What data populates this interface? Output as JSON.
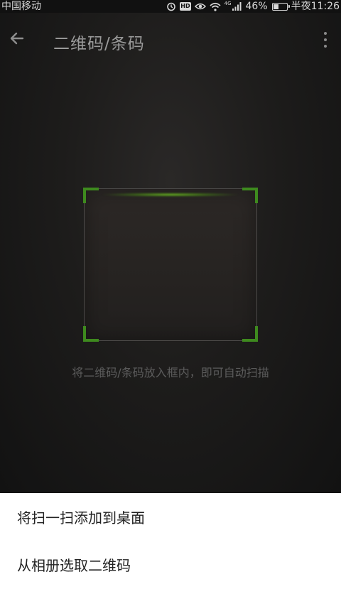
{
  "status_bar": {
    "carrier": "中国移动",
    "net_label": "4G",
    "battery_percent": "46%",
    "battery_level": 0.46,
    "time": "半夜11:26",
    "icons": [
      "alarm-icon",
      "hd-icon",
      "eye-icon",
      "wifi-icon",
      "signal-icon",
      "battery-icon"
    ],
    "hd_label": "HD"
  },
  "app_bar": {
    "title": "二维码/条码",
    "back_icon": "arrow-left-icon",
    "menu_icon": "overflow-menu-icon"
  },
  "scanner": {
    "hint": "将二维码/条码放入框内，即可自动扫描",
    "corner_color": "#3e8a1e",
    "scan_line_color": "#7ac828"
  },
  "menu": {
    "items": [
      {
        "label": "将扫一扫添加到桌面"
      },
      {
        "label": "从相册选取二维码"
      }
    ]
  }
}
